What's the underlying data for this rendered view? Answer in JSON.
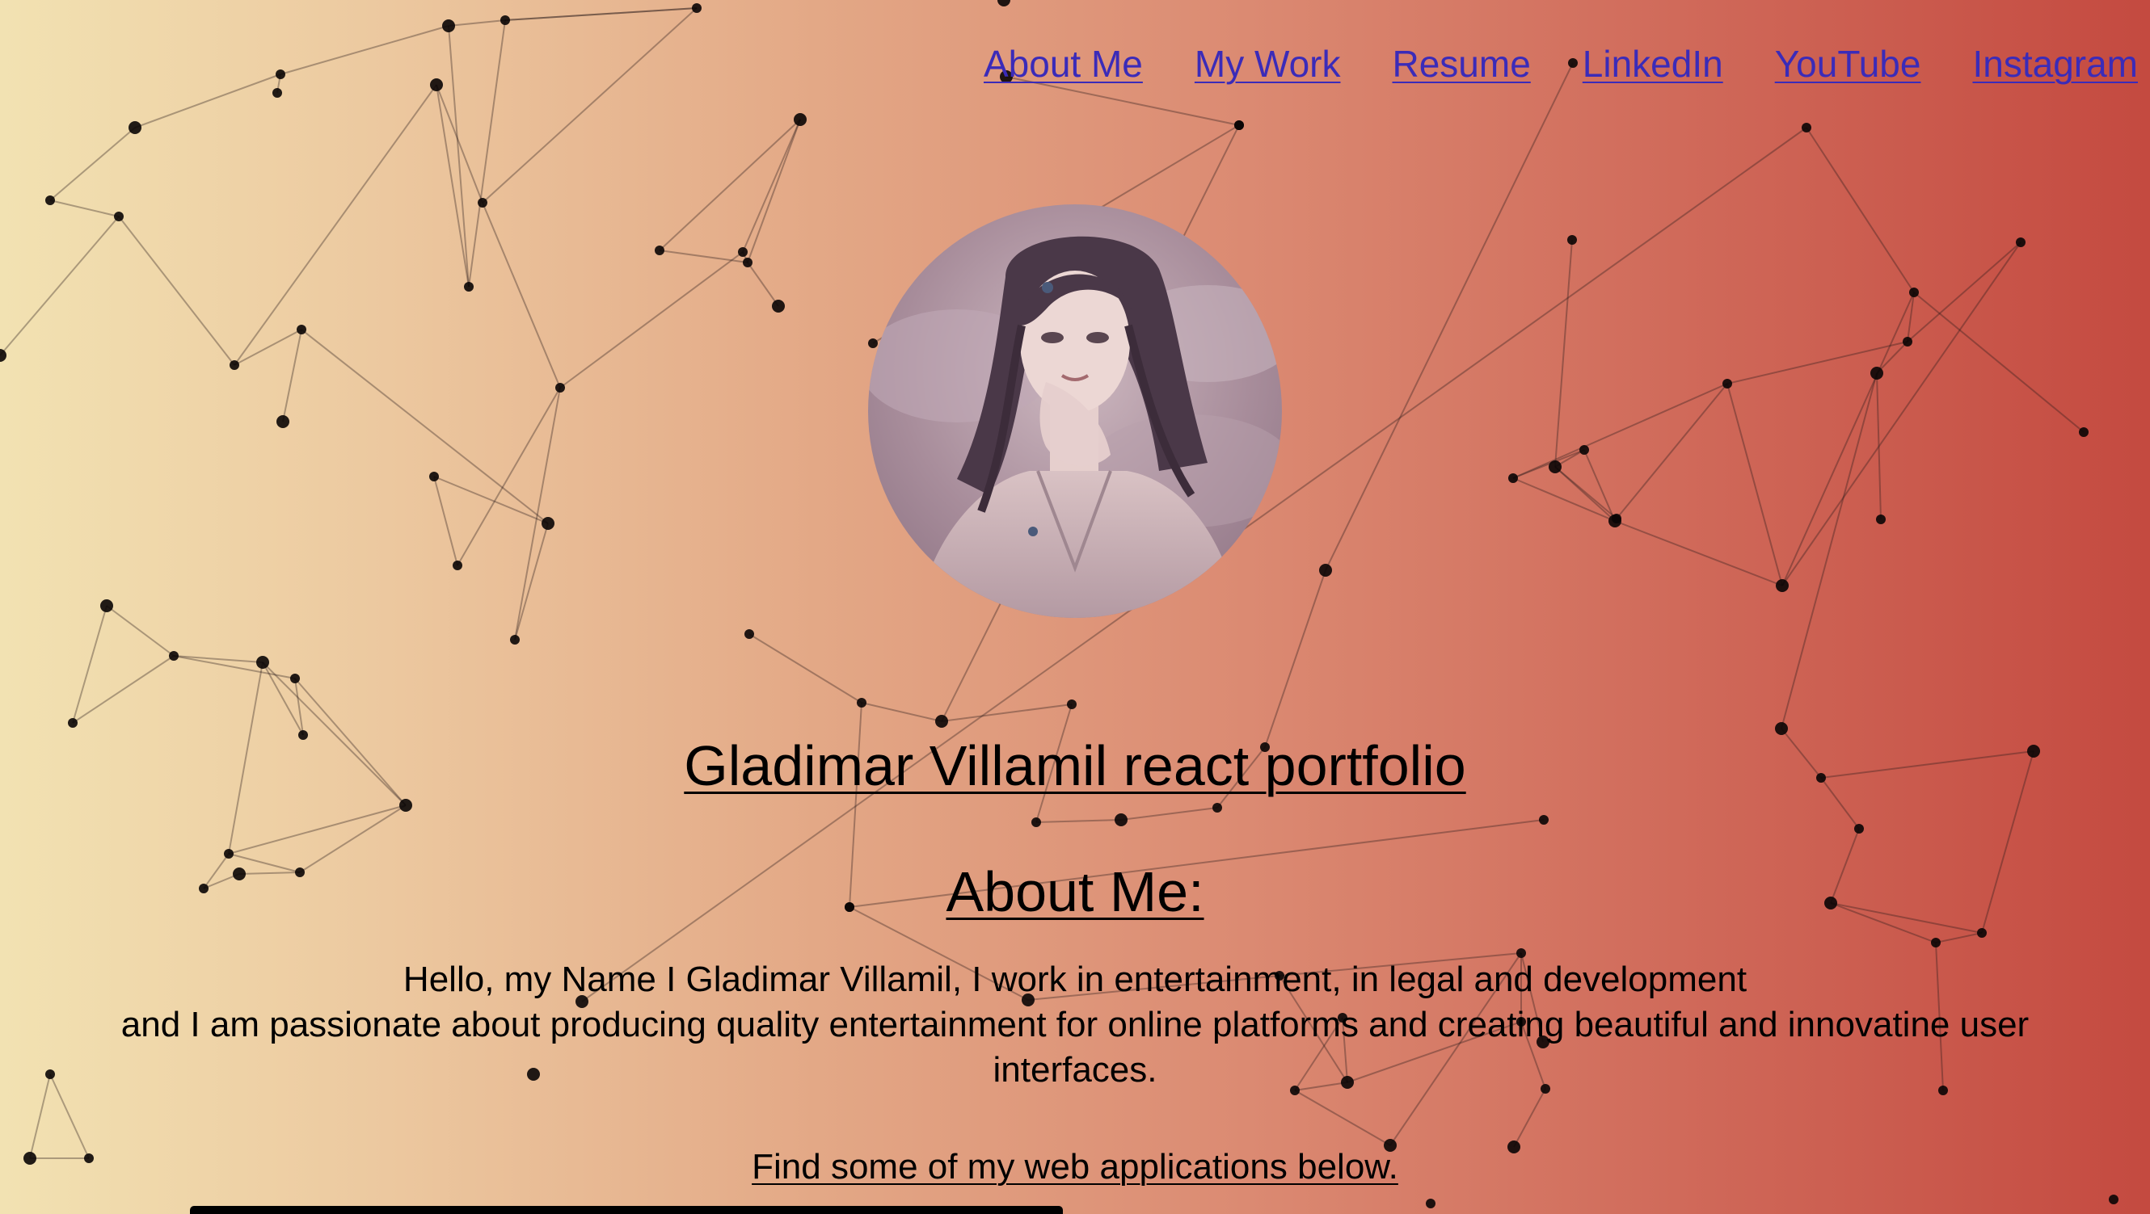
{
  "nav": {
    "items": [
      {
        "label": "About Me"
      },
      {
        "label": "My Work"
      },
      {
        "label": "Resume"
      },
      {
        "label": "LinkedIn"
      },
      {
        "label": "YouTube"
      },
      {
        "label": "Instagram"
      }
    ]
  },
  "hero": {
    "title": "Gladimar Villamil react portfolio"
  },
  "about": {
    "heading": "About Me:",
    "line1": "Hello, my Name I Gladimar Villamil, I work in entertainment, in legal and development",
    "line2": "and I am passionate about producing quality entertainment for online platforms and creating beautiful and innovatine user interfaces."
  },
  "cta": {
    "text": "Find some of my web applications below."
  },
  "colors": {
    "link": "#3b2bb8",
    "gradient_start": "#f2e2b2",
    "gradient_end": "#c44a40"
  }
}
